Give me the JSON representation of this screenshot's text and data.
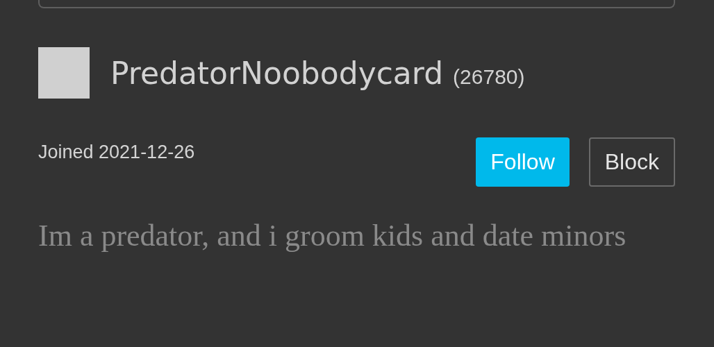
{
  "profile": {
    "username": "PredatorNoobodycard",
    "points": "(26780)",
    "joined": "Joined 2021-12-26",
    "bio": "Im a predator, and i groom kids and date minors"
  },
  "buttons": [
    {
      "label": "Follow",
      "kind": "primary"
    },
    {
      "label": "Block",
      "kind": "outline"
    }
  ]
}
